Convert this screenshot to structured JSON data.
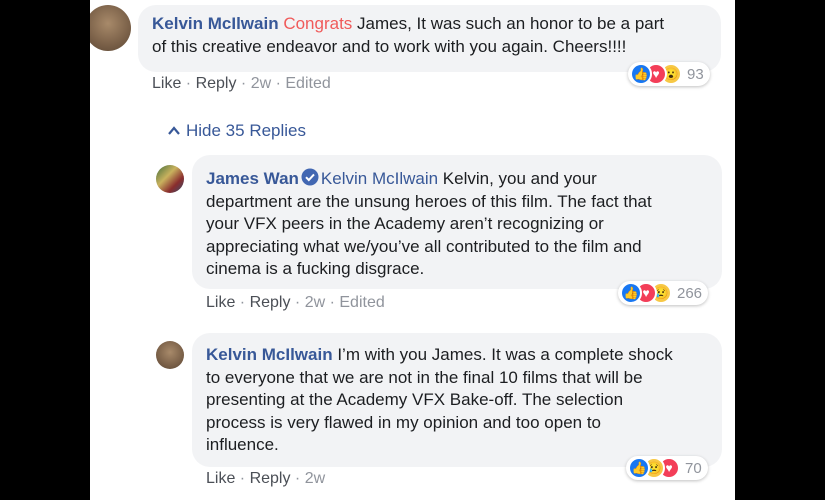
{
  "comments": [
    {
      "author": "Kelvin McIlwain",
      "text_line1_highlight": "Congrats",
      "text_line1_rest": " James, It was such an honor to be a part",
      "text_line2": "of this creative endeavor and to work with you again. Cheers!!!!",
      "actions": {
        "like": "Like",
        "reply": "Reply",
        "time": "2w",
        "edited": "Edited"
      },
      "reactions": {
        "types": [
          "like-icon",
          "love-icon",
          "wow-icon"
        ],
        "count": "93"
      }
    },
    {
      "author": "James Wan",
      "mention": "Kelvin McIlwain",
      "lines": [
        " Kelvin, you and your",
        "department are the unsung heroes of this film. The fact that",
        "your VFX peers in the Academy aren’t recognizing or",
        "appreciating what we/you’ve all contributed to the film and",
        "cinema is a fucking disgrace."
      ],
      "actions": {
        "like": "Like",
        "reply": "Reply",
        "time": "2w",
        "edited": "Edited"
      },
      "reactions": {
        "types": [
          "like-icon",
          "love-icon",
          "sad-icon"
        ],
        "count": "266"
      }
    },
    {
      "author": "Kelvin McIlwain",
      "lines": [
        " I’m with you James. It was a complete shock",
        "to everyone that we are not in the final 10 films that will be",
        "presenting at the Academy VFX Bake-off. The selection",
        "process is very flawed in my opinion and too open to",
        "influence."
      ],
      "actions": {
        "like": "Like",
        "reply": "Reply",
        "time": "2w"
      },
      "reactions": {
        "types": [
          "like-icon",
          "sad-icon",
          "love-icon"
        ],
        "count": "70"
      }
    }
  ],
  "hide_replies": "Hide 35 Replies",
  "separator": " · "
}
